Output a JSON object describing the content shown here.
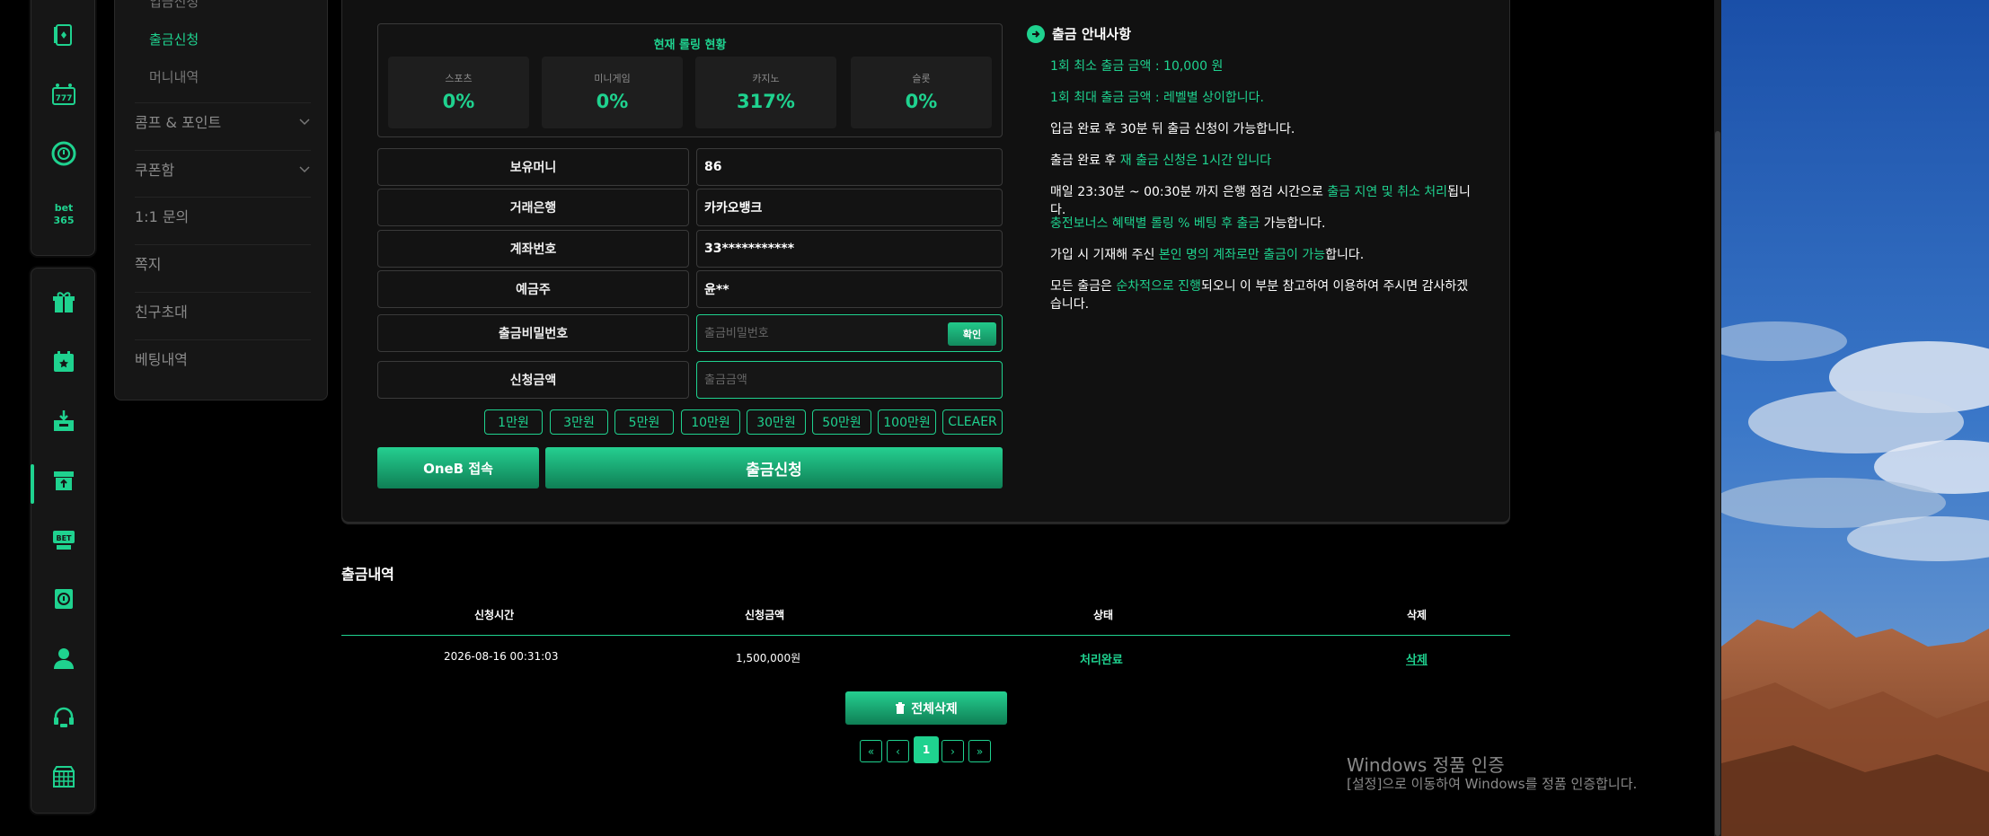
{
  "submenu": {
    "sub_items": [
      "입금신청",
      "출금신청",
      "머니내역"
    ],
    "items": [
      {
        "label": "콤프 & 포인트",
        "has_chevron": true
      },
      {
        "label": "쿠폰함",
        "has_chevron": true
      },
      {
        "label": "1:1 문의",
        "has_chevron": false
      },
      {
        "label": "쪽지",
        "has_chevron": false
      },
      {
        "label": "친구초대",
        "has_chevron": false
      },
      {
        "label": "베팅내역",
        "has_chevron": false
      }
    ]
  },
  "rail_icons": {
    "group1": [
      "card-icon",
      "slot-777-icon",
      "casino-chip-icon",
      "bet365-logo"
    ],
    "group1_text": "bet 365",
    "group2": [
      "gift-icon",
      "calendar-star-icon",
      "deposit-box-icon",
      "withdraw-box-icon",
      "bet-ticket-icon",
      "info-card-icon",
      "user-icon",
      "support-headset-icon",
      "grid-menu-icon"
    ],
    "bet_text": "BET"
  },
  "rolling": {
    "title": "현재 롤링 현황",
    "boxes": [
      {
        "label": "스포츠",
        "value": "0%"
      },
      {
        "label": "미니게임",
        "value": "0%"
      },
      {
        "label": "카지노",
        "value": "317%"
      },
      {
        "label": "슬롯",
        "value": "0%"
      }
    ]
  },
  "form": {
    "balance_label": "보유머니",
    "balance_value": "86",
    "bank_label": "거래은행",
    "bank_value": "카카오뱅크",
    "account_label": "계좌번호",
    "account_value": "33***********",
    "holder_label": "예금주",
    "holder_value": "윤**",
    "password_label": "출금비밀번호",
    "password_placeholder": "출금비밀번호",
    "confirm_label": "확인",
    "amount_label": "신청금액",
    "amount_placeholder": "출금금액"
  },
  "amount_buttons": [
    "1만원",
    "3만원",
    "5만원",
    "10만원",
    "30만원",
    "50만원",
    "100만원",
    "CLEAER"
  ],
  "buttons": {
    "oneb": "OneB 접속",
    "request": "출금신청"
  },
  "notice": {
    "title": "출금 안내사항",
    "l1": "1회 최소 출금 금액 : 10,000 원",
    "l2": "1회 최대 출금 금액 : 레벨별 상이합니다.",
    "l3": "입금 완료 후 30분 뒤 출금 신청이 가능합니다.",
    "l4a": "출금 완료 후 ",
    "l4b": "재 출금 신청은 1시간 입니다",
    "l5a": "매일 23:30분 ~ 00:30분 까지 은행 점검 시간으로 ",
    "l5b": "출금 지연 및 취소 처리",
    "l5c": "됩니다.",
    "l6a": "충전보너스 혜택별 롤링 % 베팅 후 출금",
    "l6b": " 가능합니다.",
    "l7a": "가입 시 기재해 주신 ",
    "l7b": "본인 명의 계좌로만 출금이 가능",
    "l7c": "합니다.",
    "l8a": "모든 출금은 ",
    "l8b": "순차적으로 진행",
    "l8c": "되오니 이 부분 참고하여 이용하여 주시면 감사하겠습니다."
  },
  "history": {
    "title": "출금내역",
    "headers": [
      "신청시간",
      "신청금액",
      "상태",
      "삭제"
    ],
    "rows": [
      {
        "time": "2026-08-16 00:31:03",
        "amount": "1,500,000원",
        "status": "처리완료",
        "delete": "삭제"
      }
    ],
    "delete_all": "전체삭제"
  },
  "pagination": {
    "first": "«",
    "prev": "‹",
    "current": "1",
    "next": "›",
    "last": "»"
  },
  "watermark": {
    "line1": "Windows 정품 인증",
    "line2": "[설정]으로 이동하여 Windows를 정품 인증합니다."
  },
  "colors": {
    "accent": "#1fd28f",
    "panel": "#111111",
    "background": "#000000"
  }
}
